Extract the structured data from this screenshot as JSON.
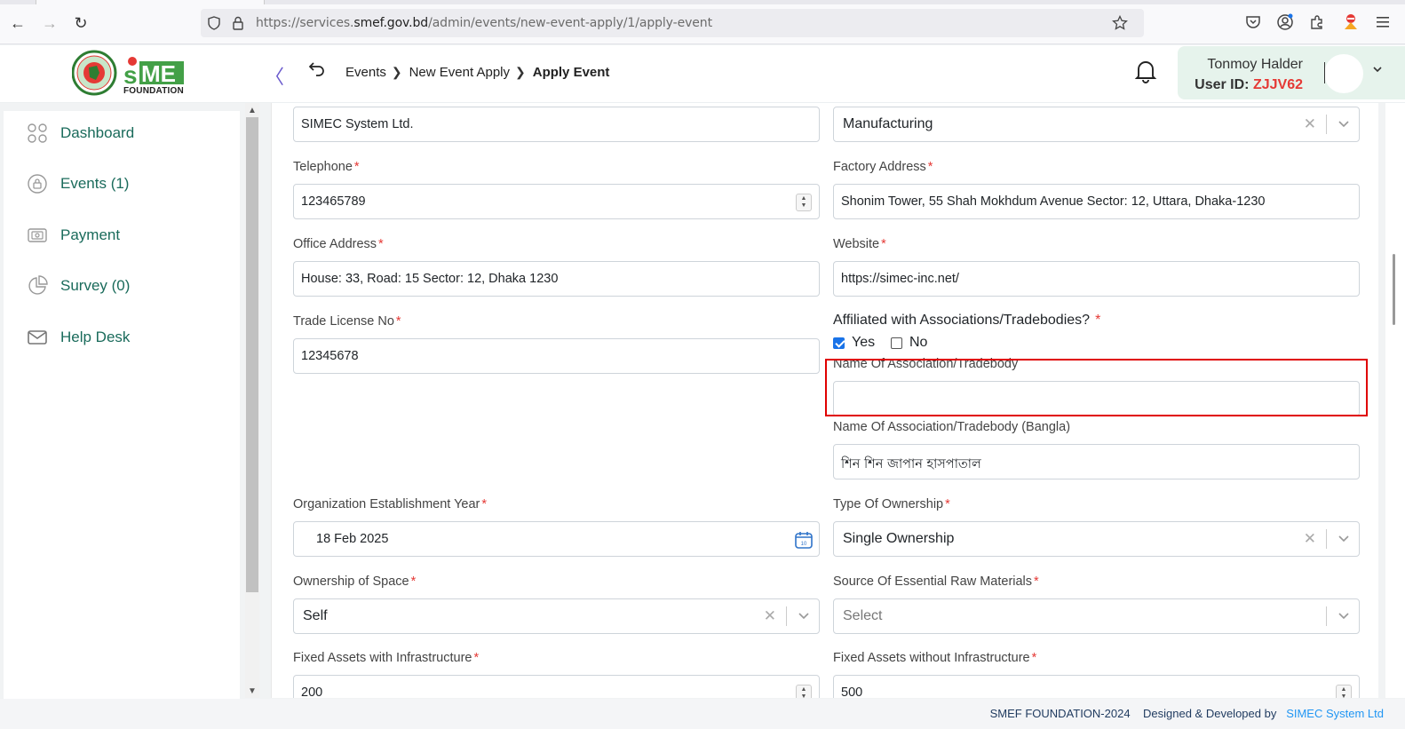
{
  "browser": {
    "url_prefix": "https://services.",
    "url_domain": "smef.gov.bd",
    "url_path": "/admin/events/new-event-apply/1/apply-event"
  },
  "header": {
    "logo_text": "FOUNDATION",
    "breadcrumb": [
      "Events",
      "New Event Apply",
      "Apply Event"
    ],
    "user_name": "Tonmoy Halder",
    "user_id_label": "User ID:",
    "user_id_value": "ZJJV62"
  },
  "sidebar": {
    "items": [
      {
        "label": "Dashboard",
        "icon": "grid-icon"
      },
      {
        "label": "Events (1)",
        "icon": "events-icon"
      },
      {
        "label": "Payment",
        "icon": "payment-icon"
      },
      {
        "label": "Survey (0)",
        "icon": "pie-icon"
      },
      {
        "label": "Help Desk",
        "icon": "mail-icon"
      }
    ]
  },
  "form": {
    "organization_name": "SIMEC System Ltd.",
    "sector": "Manufacturing",
    "telephone_label": "Telephone",
    "telephone": "123465789",
    "factory_address_label": "Factory Address",
    "factory_address": "Shonim Tower, 55 Shah Mokhdum Avenue  Sector: 12, Uttara, Dhaka-1230",
    "office_address_label": "Office Address",
    "office_address": "House: 33, Road: 15 Sector: 12, Dhaka 1230",
    "website_label": "Website",
    "website": "https://simec-inc.net/",
    "trade_license_label": "Trade License No",
    "trade_license": "12345678",
    "affiliated_question": "Affiliated with Associations/Tradebodies?",
    "yes_label": "Yes",
    "no_label": "No",
    "affiliated_yes": true,
    "association_name_label": "Name Of Association/Tradebody",
    "association_name": "",
    "association_name_bn_label": "Name Of Association/Tradebody (Bangla)",
    "association_name_bn": "শিন শিন জাপান হাসপাতাল",
    "establishment_year_label": "Organization Establishment Year",
    "establishment_year": "18 Feb 2025",
    "ownership_type_label": "Type Of Ownership",
    "ownership_type": "Single Ownership",
    "space_ownership_label": "Ownership of Space",
    "space_ownership": "Self",
    "raw_materials_label": "Source Of Essential Raw Materials",
    "raw_materials_placeholder": "Select",
    "fixed_assets_infra_label": "Fixed Assets with Infrastructure",
    "fixed_assets_infra": "200",
    "fixed_assets_no_infra_label": "Fixed Assets without Infrastructure",
    "fixed_assets_no_infra": "500",
    "required_mark": "*"
  },
  "footer": {
    "copyright": "SMEF FOUNDATION-2024",
    "designed_by": "Designed & Developed by",
    "developer": "SIMEC System Ltd"
  },
  "colors": {
    "sidebar_text": "#1a6b5b",
    "required": "#e53935",
    "highlight": "#e00000",
    "user_card": "#e6f3ec"
  }
}
